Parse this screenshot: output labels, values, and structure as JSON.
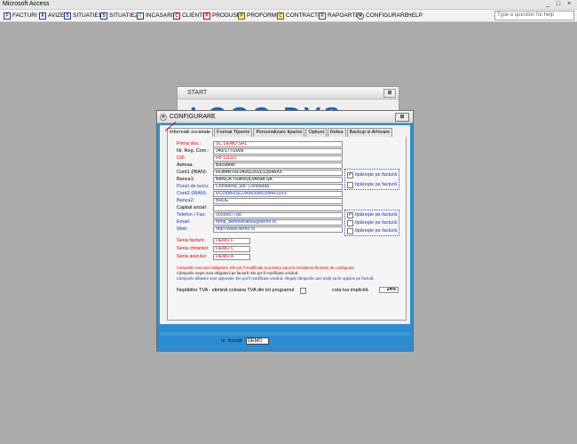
{
  "window": {
    "title": "Microsoft Access",
    "controls": [
      "_",
      "□",
      "×"
    ]
  },
  "menu": [
    {
      "label": "FACTURI",
      "icon": "invoice-icon",
      "glyph": "F"
    },
    {
      "label": "AVIZE",
      "icon": "notice-icon",
      "glyph": "A"
    },
    {
      "label": "SITUATIE1",
      "icon": "report-icon",
      "glyph": "S"
    },
    {
      "label": "SITUATIE2",
      "icon": "report-icon",
      "glyph": "S"
    },
    {
      "label": "INCASARI",
      "icon": "receipt-icon",
      "glyph": "I"
    },
    {
      "label": "CLIENTI",
      "icon": "clients-icon",
      "glyph": "C"
    },
    {
      "label": "PRODUSE",
      "icon": "products-icon",
      "glyph": "P"
    },
    {
      "label": "PROFORME",
      "icon": "proforma-icon",
      "glyph": "P"
    },
    {
      "label": "CONTRACTE",
      "icon": "contract-icon",
      "glyph": "C"
    },
    {
      "label": "RAPOARTE",
      "icon": "reports-icon",
      "glyph": "R"
    },
    {
      "label": "CONFIGURARE",
      "icon": "gear-icon",
      "glyph": "✱"
    },
    {
      "label": "HELP",
      "icon": "",
      "glyph": ""
    }
  ],
  "help_placeholder": "Type a question for help",
  "start_window": {
    "title": "START",
    "logo": "LOGO DVS",
    "close": "⊠"
  },
  "config": {
    "title": "CONFIGURARE",
    "close": "⊠",
    "tabs": [
      "Informatii societate",
      "Format Tiparire",
      "Personalizare tiparire",
      "Optiuni",
      "Retea",
      "Backup si Arhivare"
    ],
    "fields": [
      {
        "label": "Firma dvs.:",
        "value": "SC DEMO SRL",
        "color": "red"
      },
      {
        "label": "Nr. Reg. Com.:",
        "value": "J40/177/2009",
        "color": "black"
      },
      {
        "label": "CIF:",
        "value": "Ro 111111",
        "color": "red"
      },
      {
        "label": "Adresa:",
        "value": "Bucuresti",
        "color": "black"
      },
      {
        "label": "Cont1 (IBAN):",
        "value": "RO84BTRL04001202D13548XX",
        "color": "black"
      },
      {
        "label": "Banca1:",
        "value": "BANCA TRANSILVANIA SA",
        "color": "black"
      },
      {
        "label": "Punct de lucru:",
        "value": "Constanta, jud. Constanta",
        "color": "blue"
      },
      {
        "label": "Cont2 (IBAN):",
        "value": "RO28BRDE234963985394RO3XX",
        "color": "blue"
      },
      {
        "label": "Banca2:",
        "value": "BRDE",
        "color": "blue"
      },
      {
        "label": "Capital social:",
        "value": "",
        "color": "black"
      },
      {
        "label": "Telefon / Fax:",
        "value": "0055667788",
        "color": "blue"
      },
      {
        "label": "Email:",
        "value": "firma_demostrativa@demo.ro",
        "color": "blue"
      },
      {
        "label": "Web:",
        "value": "http://www.demo.ro",
        "color": "blue"
      }
    ],
    "checks": [
      {
        "label": "tipăreşte pe factură",
        "checked": true,
        "mark": "✓"
      },
      {
        "label": "tipăreşte pe factură",
        "checked": false,
        "mark": ""
      },
      {
        "label": "tipăreşte pe factură",
        "checked": true,
        "mark": "✓"
      },
      {
        "label": "tipăreşte pe factură",
        "checked": false,
        "mark": ""
      },
      {
        "label": "tipăreşte pe factură",
        "checked": false,
        "mark": ""
      }
    ],
    "series": [
      {
        "label": "Seria facturii:",
        "value": "DEMO F"
      },
      {
        "label": "Seria chitantei:",
        "value": "DEMO C"
      },
      {
        "label": "Seria avizului:",
        "value": "DEMO A"
      }
    ],
    "notes": [
      {
        "text": "Campurile rosii sunt obligatorii. Ele pot fi modificate la activare pana la inchiderea ferestrei de configurare.",
        "color": "#d00000"
      },
      {
        "text": "Câmpurile negre sunt obligatorii pe factură. Ele pot fi modificate oricând.",
        "color": "#222222"
      },
      {
        "text": "Câmpurile albastre sunt opţionale. Ele pot fi modificate oricând. Alegeţi câmpurile care doriţi sa fie opţiune pe factură.",
        "color": "#1a3aa8"
      }
    ],
    "tva_label": "Neplătitor TVA - elimină coloana TVA din tot programul",
    "cota_label": "cota tva implicită",
    "cota_value": "24%"
  },
  "license": {
    "label": "nr. licenţă",
    "value": "DEMO"
  }
}
